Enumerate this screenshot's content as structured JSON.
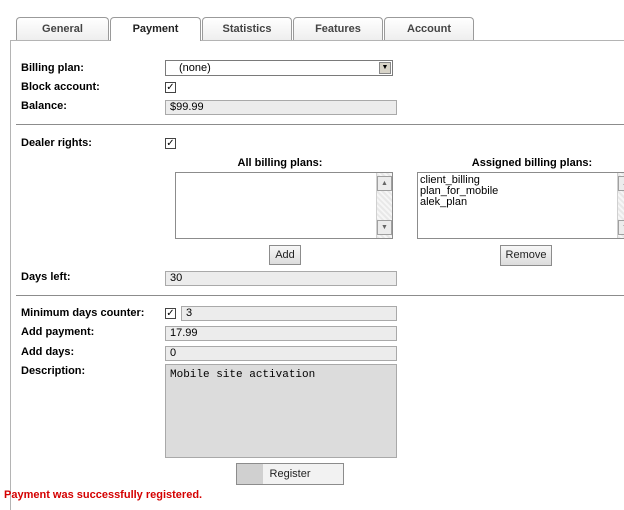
{
  "tabs": [
    {
      "label": "General"
    },
    {
      "label": "Payment"
    },
    {
      "label": "Statistics"
    },
    {
      "label": "Features"
    },
    {
      "label": "Account"
    }
  ],
  "billing": {
    "plan_label": "Billing plan:",
    "plan_value": "(none)",
    "block_label": "Block account:",
    "block_checked": true,
    "balance_label": "Balance:",
    "balance_value": "$99.99"
  },
  "dealer": {
    "rights_label": "Dealer rights:",
    "rights_checked": true,
    "all_plans_header": "All billing plans:",
    "all_plans": [],
    "assigned_header": "Assigned billing plans:",
    "assigned_plans": [
      "client_billing",
      "plan_for_mobile",
      "alek_plan"
    ],
    "add_label": "Add",
    "remove_label": "Remove",
    "days_left_label": "Days left:",
    "days_left_value": "30"
  },
  "payment": {
    "min_days_label": "Minimum days counter:",
    "min_days_checked": true,
    "min_days_value": "3",
    "add_payment_label": "Add payment:",
    "add_payment_value": "17.99",
    "add_days_label": "Add days:",
    "add_days_value": "0",
    "description_label": "Description:",
    "description_value": "Mobile site activation",
    "register_label": "Register"
  },
  "status": {
    "message": "Payment was successfully registered.",
    "color": "#d40000"
  }
}
